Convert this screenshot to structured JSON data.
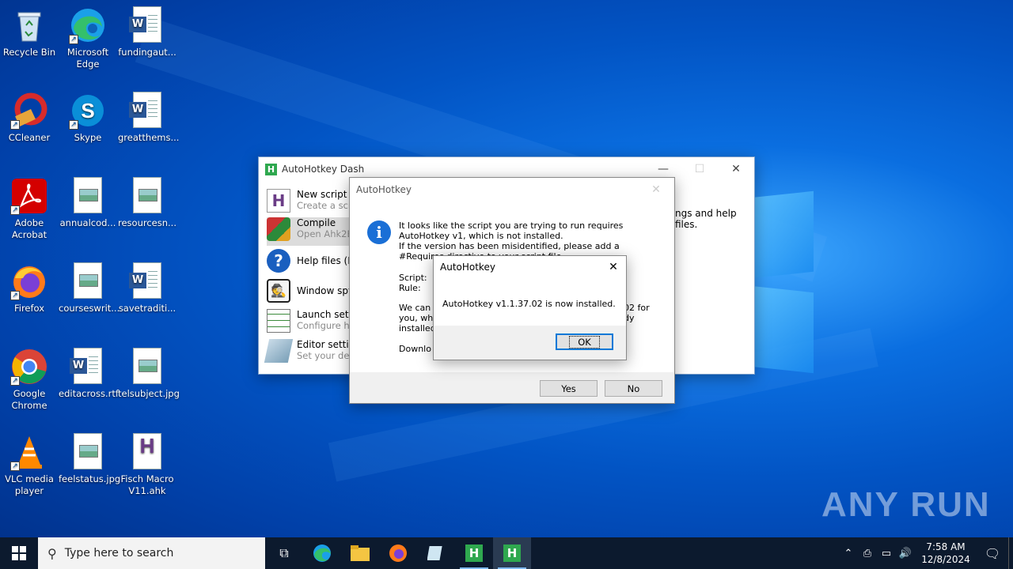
{
  "desktop": {
    "icons": [
      {
        "label": "Recycle Bin"
      },
      {
        "label": "Microsoft Edge"
      },
      {
        "label": "fundingaut..."
      },
      {
        "label": "CCleaner"
      },
      {
        "label": "Skype"
      },
      {
        "label": "greatthems..."
      },
      {
        "label": "Adobe Acrobat"
      },
      {
        "label": "annualcod..."
      },
      {
        "label": "resourcesn..."
      },
      {
        "label": "Firefox"
      },
      {
        "label": "courseswrit..."
      },
      {
        "label": "savetraditi..."
      },
      {
        "label": "Google Chrome"
      },
      {
        "label": "editacross.rtf"
      },
      {
        "label": "telsubject.jpg"
      },
      {
        "label": "VLC media player"
      },
      {
        "label": "feelstatus.jpg"
      },
      {
        "label": "Fisch Macro V11.ahk"
      }
    ],
    "watermark": "ANY RUN"
  },
  "dash": {
    "title": "AutoHotkey Dash",
    "items": [
      {
        "title": "New script",
        "sub": "Create a scri"
      },
      {
        "title": "Compile",
        "sub": "Open Ahk2E"
      },
      {
        "title": "Help files (F1",
        "sub": ""
      },
      {
        "title": "Window spy",
        "sub": ""
      },
      {
        "title": "Launch setti",
        "sub": "Configure h"
      },
      {
        "title": "Editor setting",
        "sub": "Set your def"
      }
    ],
    "right_text": "ngs and help files."
  },
  "dialog1": {
    "title": "AutoHotkey",
    "message": "It looks like the script you are trying to run requires AutoHotkey v1, which is not installed.",
    "message2": "If the version has been misidentified, please add a #Requires directive to your script file.",
    "script_label": "Script:",
    "rule_label": "Rule:",
    "body_left": "We can t\nyou, whi\ninstalled",
    "body_right": "02 for\ndy",
    "download_label": "Downlo",
    "yes": "Yes",
    "no": "No"
  },
  "dialog2": {
    "title": "AutoHotkey",
    "message": "AutoHotkey v1.1.37.02 is now installed.",
    "ok": "OK"
  },
  "taskbar": {
    "search_placeholder": "Type here to search",
    "time": "7:58 AM",
    "date": "12/8/2024"
  }
}
